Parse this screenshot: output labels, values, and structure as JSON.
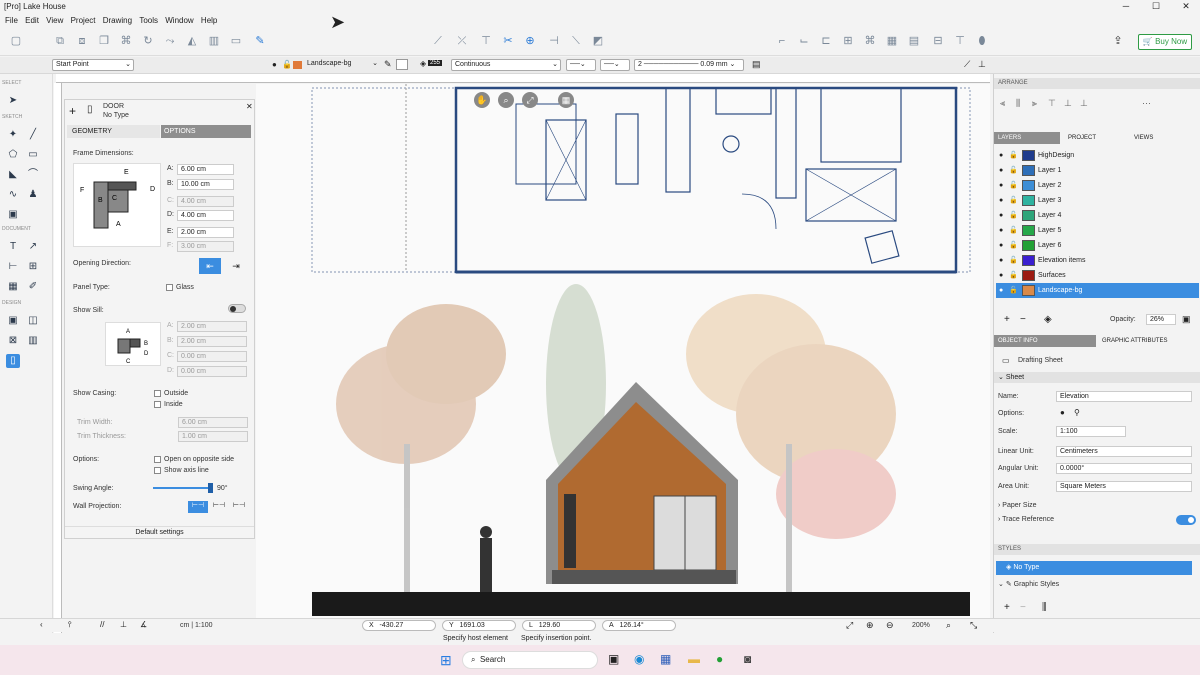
{
  "window": {
    "title": "[Pro] Lake House"
  },
  "menu": [
    "File",
    "Edit",
    "View",
    "Project",
    "Drawing",
    "Tools",
    "Window",
    "Help"
  ],
  "toolbar": {
    "buy_label": "Buy Now"
  },
  "propbar": {
    "snap_mode": "Start Point",
    "layer": "Landscape-bg",
    "opacity_val": "255",
    "line_style": "Continuous",
    "weight_num": "2",
    "line_weight": "0.09 mm"
  },
  "left_tools": {
    "select_label": "SELECT",
    "sketch_label": "SKETCH",
    "document_label": "DOCUMENT",
    "design_label": "DESIGN"
  },
  "door_panel": {
    "title": "DOOR",
    "type": "No Type",
    "tabs": [
      "GEOMETRY",
      "OPTIONS"
    ],
    "frame_dim_label": "Frame Dimensions:",
    "dims": [
      {
        "k": "A:",
        "v": "6.00 cm",
        "en": true
      },
      {
        "k": "B:",
        "v": "10.00 cm",
        "en": true
      },
      {
        "k": "C:",
        "v": "4.00 cm",
        "en": false
      },
      {
        "k": "D:",
        "v": "4.00 cm",
        "en": true
      },
      {
        "k": "E:",
        "v": "2.00 cm",
        "en": true
      },
      {
        "k": "F:",
        "v": "3.00 cm",
        "en": false
      }
    ],
    "opening_dir_label": "Opening Direction:",
    "panel_type_label": "Panel Type:",
    "glass_label": "Glass",
    "show_sill_label": "Show Sill:",
    "sill_dims": [
      {
        "k": "A:",
        "v": "2.00 cm"
      },
      {
        "k": "B:",
        "v": "2.00 cm"
      },
      {
        "k": "C:",
        "v": "0.00 cm"
      },
      {
        "k": "D:",
        "v": "0.00 cm"
      }
    ],
    "show_casing_label": "Show Casing:",
    "outside_label": "Outside",
    "inside_label": "Inside",
    "trim_width_label": "Trim Width:",
    "trim_width": "6.00 cm",
    "trim_thickness_label": "Trim Thickness:",
    "trim_thickness": "1.00 cm",
    "options_label": "Options:",
    "opt1": "Open on opposite side",
    "opt2": "Show axis line",
    "swing_label": "Swing Angle:",
    "swing_value": "90°",
    "wall_proj_label": "Wall Projection:",
    "default_label": "Default settings"
  },
  "right_panel": {
    "arrange_label": "ARRANGE",
    "tabs": [
      "LAYERS",
      "PROJECT",
      "VIEWS"
    ],
    "layers": [
      {
        "name": "HighDesign",
        "color": "#1f3b8c"
      },
      {
        "name": "Layer 1",
        "color": "#2e6fb8"
      },
      {
        "name": "Layer 2",
        "color": "#3d8ed6"
      },
      {
        "name": "Layer 3",
        "color": "#2fb3a0"
      },
      {
        "name": "Layer 4",
        "color": "#2ea57a"
      },
      {
        "name": "Layer 5",
        "color": "#26a84a"
      },
      {
        "name": "Layer 6",
        "color": "#22a035"
      },
      {
        "name": "Elevation items",
        "color": "#3a1fd0"
      },
      {
        "name": "Surfaces",
        "color": "#9b1a12"
      },
      {
        "name": "Landscape-bg",
        "color": "#d98a4a"
      }
    ],
    "opacity_label": "Opacity:",
    "opacity_value": "26%",
    "info_tabs": [
      "OBJECT INFO",
      "GRAPHIC ATTRIBUTES"
    ],
    "drafting_sheet": "Drafting Sheet",
    "sheet_label": "Sheet",
    "fields": [
      {
        "k": "Name:",
        "v": "Elevation"
      },
      {
        "k": "Scale:",
        "v": "1:100"
      },
      {
        "k": "Linear Unit:",
        "v": "Centimeters"
      },
      {
        "k": "Angular Unit:",
        "v": "0.0000°"
      },
      {
        "k": "Area Unit:",
        "v": "Square Meters"
      }
    ],
    "options_label": "Options:",
    "paper_size": "Paper Size",
    "trace_ref": "Trace Reference",
    "styles_label": "STYLES",
    "no_type": "No Type",
    "graphic_styles": "Graphic Styles"
  },
  "status": {
    "units": "cm | 1:100",
    "x": "-430.27",
    "y": "1691.03",
    "l": "129.60",
    "a": "126.14°",
    "x_label": "X",
    "y_label": "Y",
    "l_label": "L",
    "a_label": "A",
    "zoom": "200%",
    "hint1": "Specify host element",
    "hint2": "Specify insertion point."
  },
  "taskbar": {
    "search": "Search"
  }
}
